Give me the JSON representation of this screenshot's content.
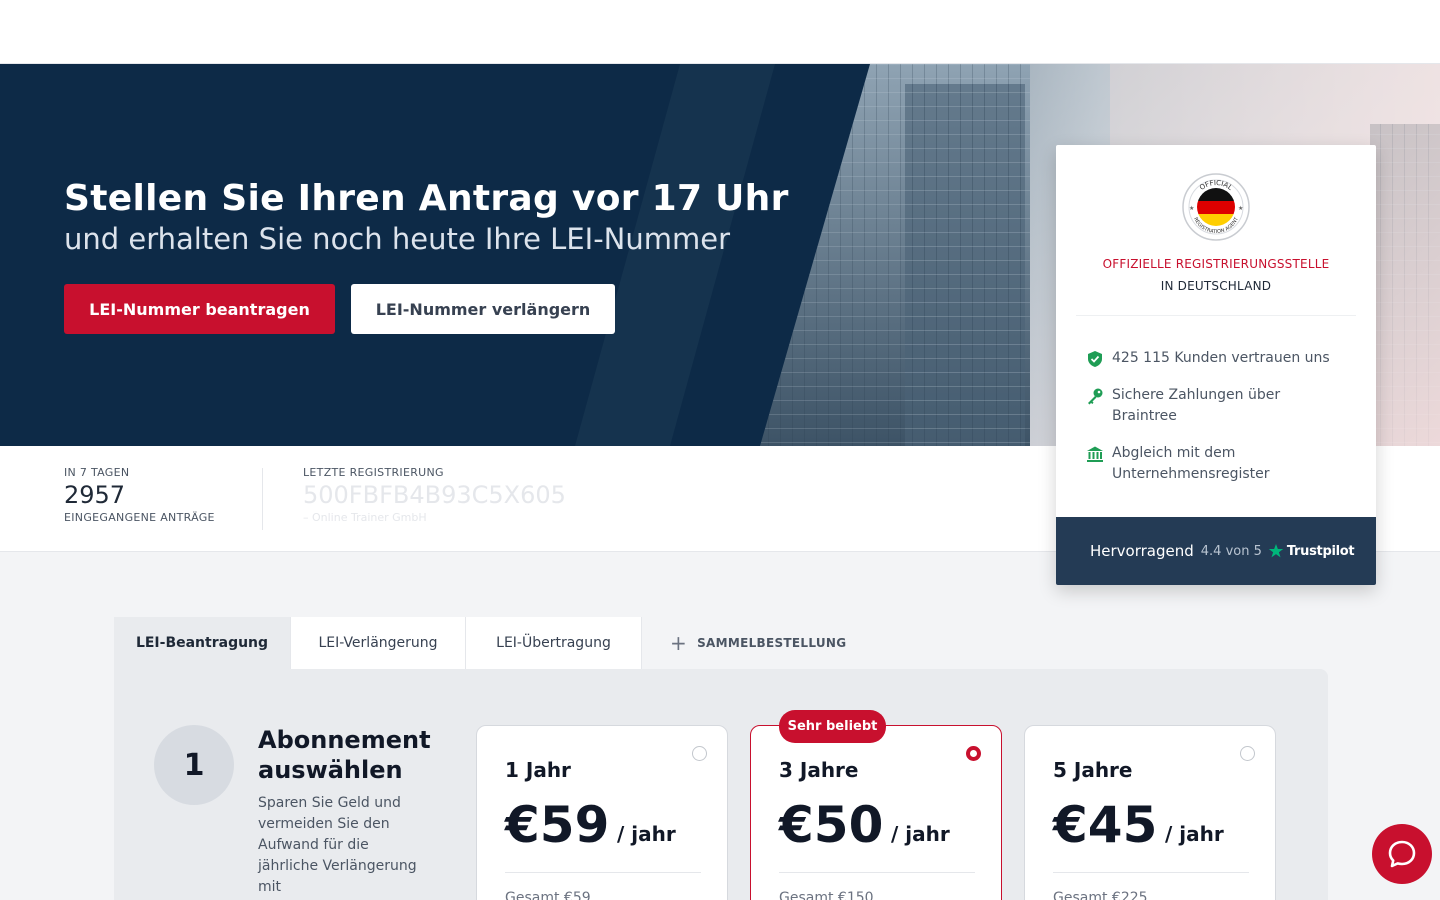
{
  "hero": {
    "title": "Stellen Sie Ihren Antrag vor 17 Uhr",
    "subtitle": "und erhalten Sie noch heute Ihre LEI-Nummer",
    "primary_button": "LEI-Nummer beantragen",
    "secondary_button": "LEI-Nummer verlängern"
  },
  "stats": {
    "period_label": "IN 7 TAGEN",
    "count": "2957",
    "count_label": "EINGEGANGENE ANTRÄGE",
    "last_reg_label": "LETZTE REGISTRIERUNG",
    "last_reg_code": "500FBFB4B93C5X605",
    "last_reg_company": "– Online Trainer GmbH"
  },
  "card": {
    "seal_top": "OFFICIAL",
    "seal_bottom": "REGISTRATION AGENT",
    "official_label": "OFFIZIELLE REGISTRIERUNGSSTELLE",
    "country_label": "IN DEUTSCHLAND",
    "features": [
      {
        "icon": "shield-check-icon",
        "text": "425 115 Kunden vertrauen uns"
      },
      {
        "icon": "key-icon",
        "text": "Sichere Zahlungen über Braintree"
      },
      {
        "icon": "bank-icon",
        "text": "Abgleich mit dem Unternehmensregister"
      }
    ],
    "rating_word": "Hervorragend",
    "rating_score": "4.4 von 5",
    "trustpilot": "Trustpilot"
  },
  "tabs": [
    {
      "label": "LEI-Beantragung",
      "active": true
    },
    {
      "label": "LEI-Verlängerung",
      "active": false
    },
    {
      "label": "LEI-Übertragung",
      "active": false
    }
  ],
  "bulk_tab": {
    "label": "SAMMELBESTELLUNG",
    "icon": "plus-icon"
  },
  "step": {
    "number": "1",
    "title": "Abonnement auswählen",
    "description": "Sparen Sie Geld und vermeiden Sie den Aufwand für die jährliche Verlängerung mit"
  },
  "plans": [
    {
      "name": "1 Jahr",
      "price": "€59",
      "per": "/ jahr",
      "total": "Gesamt €59",
      "selected": false
    },
    {
      "name": "3 Jahre",
      "price": "€50",
      "per": "/ jahr",
      "total": "Gesamt €150",
      "selected": true
    },
    {
      "name": "5 Jahre",
      "price": "€45",
      "per": "/ jahr",
      "total": "Gesamt €225",
      "selected": false
    }
  ],
  "popular_badge": "Sehr beliebt",
  "colors": {
    "brand_red": "#c8102e",
    "navy": "#0d2a47",
    "card_footer": "#243b55",
    "trust_green": "#00b67a"
  }
}
